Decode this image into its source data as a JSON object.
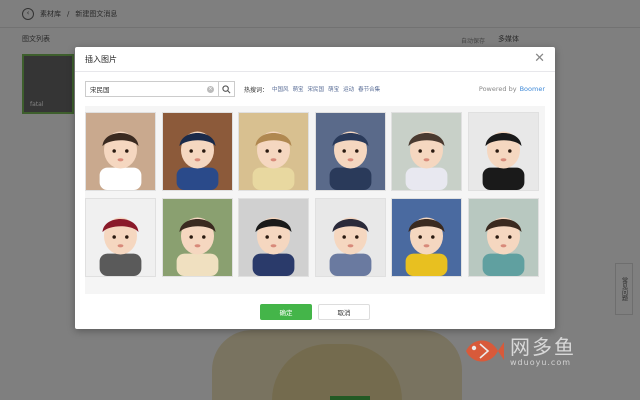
{
  "background": {
    "breadcrumb_root": "素材库",
    "breadcrumb_sep": "/",
    "breadcrumb_current": "新建图文消息",
    "left_title": "图文列表",
    "thumb_caption": "fatal",
    "autosave": "自动保存",
    "right_col_title": "多媒体",
    "side_button": "常见问题",
    "colors": {
      "accent": "#44b549",
      "link": "#576b95"
    }
  },
  "modal": {
    "title": "插入图片",
    "close_icon": "close-icon",
    "search": {
      "value": "宋民国",
      "clear_icon": "clear-icon",
      "search_icon": "search-icon"
    },
    "hot_label": "热搜词：",
    "hot_tags": [
      "中国风",
      "萌宝",
      "宋民国",
      "萌宝",
      "运动",
      "春节合集"
    ],
    "powered_by": "Powered by",
    "brand": "Boomer",
    "images": [
      {
        "name": "baby-photo-1",
        "bg": "#c9a98e",
        "hair": "#3a2a20",
        "shirt": "#ffffff"
      },
      {
        "name": "baby-photo-2",
        "bg": "#8c5a3a",
        "hair": "#1a2a4a",
        "shirt": "#2a4a8a"
      },
      {
        "name": "baby-photo-3",
        "bg": "#d8c090",
        "hair": "#b08850",
        "shirt": "#e8d8a0"
      },
      {
        "name": "baby-photo-4",
        "bg": "#5a6a8a",
        "hair": "#2a3a5a",
        "shirt": "#2a3a5a"
      },
      {
        "name": "baby-photo-5",
        "bg": "#c8d0c8",
        "hair": "#4a3a30",
        "shirt": "#e8e8f0"
      },
      {
        "name": "baby-photo-6",
        "bg": "#e8e8e8",
        "hair": "#1a1a1a",
        "shirt": "#1a1a1a"
      },
      {
        "name": "baby-photo-7",
        "bg": "#f0f0f0",
        "hair": "#8a1a2a",
        "shirt": "#5a5a5a"
      },
      {
        "name": "baby-photo-8",
        "bg": "#8aa070",
        "hair": "#3a2a20",
        "shirt": "#f0e0c0"
      },
      {
        "name": "baby-photo-9",
        "bg": "#d0d0d0",
        "hair": "#1a1a1a",
        "shirt": "#2a3a6a"
      },
      {
        "name": "baby-photo-10",
        "bg": "#e8e8e8",
        "hair": "#2a2a3a",
        "shirt": "#6a7aa0"
      },
      {
        "name": "baby-photo-11",
        "bg": "#4a6aa0",
        "hair": "#3a2a20",
        "shirt": "#e8c020"
      },
      {
        "name": "baby-photo-12",
        "bg": "#b8c8c0",
        "hair": "#3a2a20",
        "shirt": "#60a0a0"
      }
    ],
    "ok_label": "确定",
    "cancel_label": "取消"
  },
  "watermark": {
    "title": "网多鱼",
    "domain": "wduoyu.com"
  }
}
